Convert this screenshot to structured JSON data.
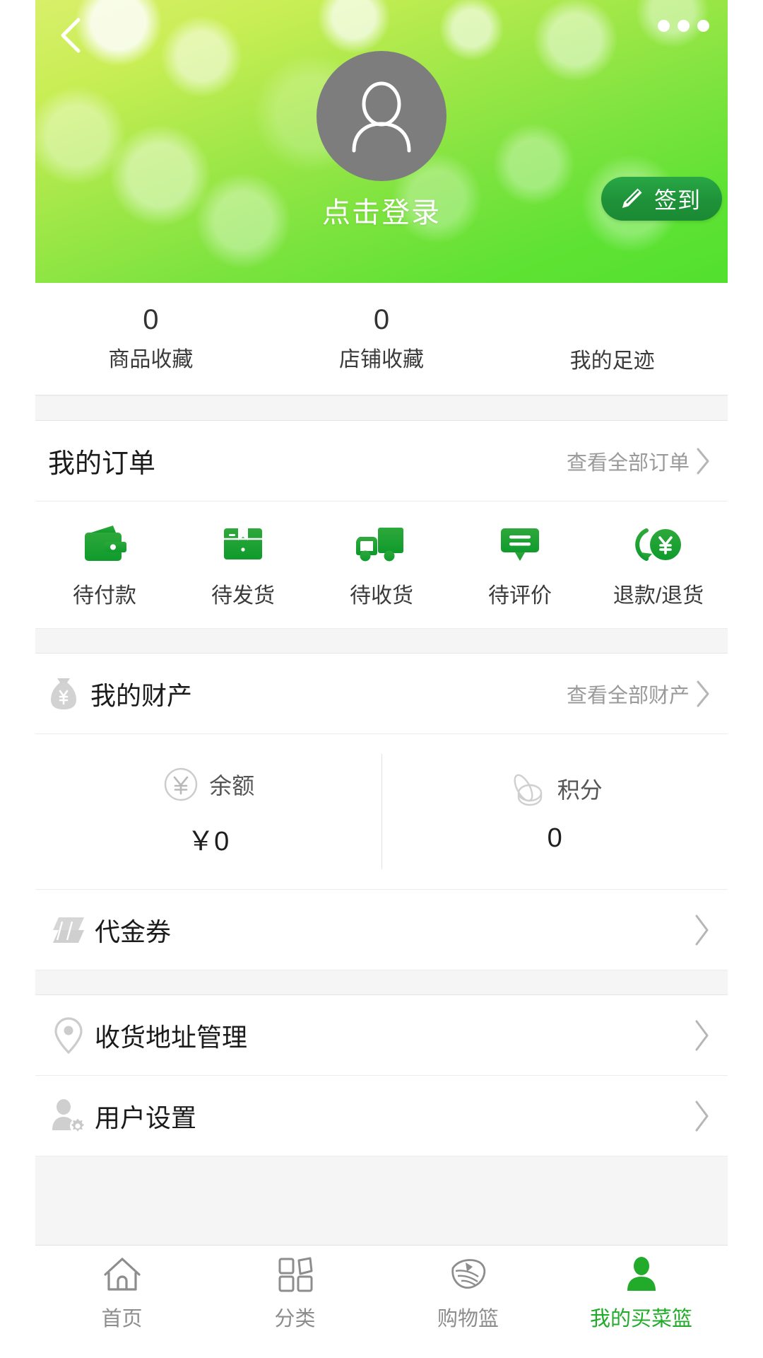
{
  "header": {
    "back_icon": "chevron-left-icon",
    "menu_icon": "more-dots-icon",
    "avatar_icon": "user-avatar-placeholder-icon",
    "login_label": "点击登录",
    "signin_label": "签到",
    "signin_icon": "pencil-icon",
    "accent_green": "#52e02e",
    "signin_button_color": "#1f9239"
  },
  "stats": [
    {
      "value": "0",
      "label": "商品收藏"
    },
    {
      "value": "0",
      "label": "店铺收藏"
    },
    {
      "value": "",
      "label": "我的足迹"
    }
  ],
  "orders": {
    "title": "我的订单",
    "more_label": "查看全部订单",
    "items": [
      {
        "label": "待付款",
        "icon": "wallet-icon"
      },
      {
        "label": "待发货",
        "icon": "package-box-icon"
      },
      {
        "label": "待收货",
        "icon": "delivery-truck-icon"
      },
      {
        "label": "待评价",
        "icon": "comment-bubble-icon"
      },
      {
        "label": "退款/退货",
        "icon": "refund-yen-icon"
      }
    ],
    "icon_color": "#1f9c33"
  },
  "assets": {
    "title": "我的财产",
    "title_icon": "money-bag-icon",
    "more_label": "查看全部财产",
    "items": [
      {
        "label": "余额",
        "value": "￥0",
        "icon": "yen-circle-icon"
      },
      {
        "label": "积分",
        "value": "0",
        "icon": "coins-stack-icon"
      }
    ]
  },
  "menu": {
    "voucher": {
      "label": "代金券",
      "icon": "voucher-ticket-icon"
    },
    "address": {
      "label": "收货地址管理",
      "icon": "location-pin-icon"
    },
    "settings": {
      "label": "用户设置",
      "icon": "user-gear-icon"
    },
    "chevron_icon": "chevron-right-icon"
  },
  "tabbar": {
    "items": [
      {
        "label": "首页",
        "icon": "home-icon",
        "active": false
      },
      {
        "label": "分类",
        "icon": "grid-categories-icon",
        "active": false
      },
      {
        "label": "购物篮",
        "icon": "basket-icon",
        "active": false
      },
      {
        "label": "我的买菜篮",
        "icon": "person-icon",
        "active": true
      }
    ],
    "active_color": "#22ab2a",
    "inactive_color": "#8d8d8d"
  }
}
